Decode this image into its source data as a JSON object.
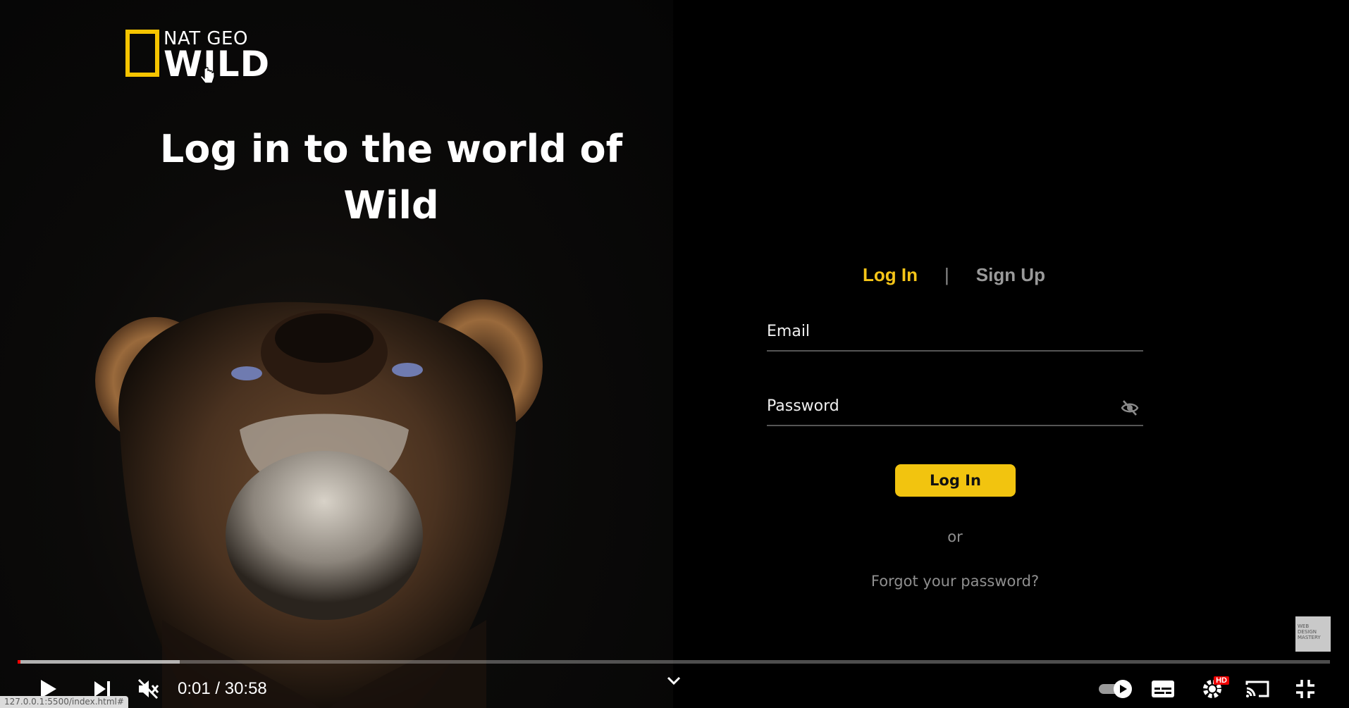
{
  "logo": {
    "top": "NAT GEO",
    "main": "WILD"
  },
  "form": {
    "heading": "Log in to the world of Wild",
    "tab_login": "Log In",
    "tab_separator": "|",
    "tab_signup": "Sign Up",
    "email_placeholder": "Email",
    "password_placeholder": "Password",
    "login_button": "Log In",
    "or_text": "or",
    "forgot_link": "Forgot your password?"
  },
  "watermark": "WEB DESIGN MASTERY",
  "player": {
    "time": "0:01 / 30:58",
    "progress_fraction": 0.001,
    "hd_badge": "HD"
  },
  "status_url": "127.0.0.1:5500/index.html#",
  "colors": {
    "accent": "#f5c518",
    "button": "#f2c40f",
    "muted": "#8f8f8f",
    "progress": "#ff0000"
  }
}
